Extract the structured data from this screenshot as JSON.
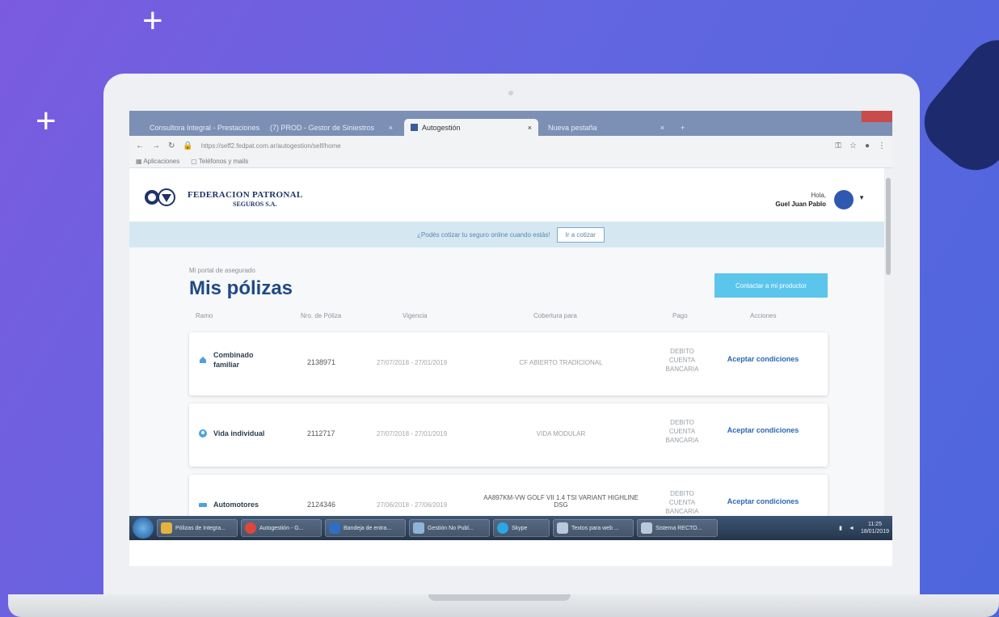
{
  "browser": {
    "tabs": [
      {
        "label": "Consultora Integral - Prestaciones"
      },
      {
        "label": "(7) PROD - Gestor de Siniestros"
      },
      {
        "label": "Autogestión"
      },
      {
        "label": "Nueva pestaña"
      }
    ],
    "url": "https://seff2.fedpat.com.ar/autogestion/self/home",
    "bookmarks": [
      {
        "label": "Aplicaciones"
      },
      {
        "label": "Teléfonos y mails"
      }
    ]
  },
  "header": {
    "brand_line1": "FEDERACION PATRONAL",
    "brand_line2": "SEGUROS S.A.",
    "greeting": "Hola,",
    "user_name": "Guel Juan Pablo"
  },
  "banner": {
    "text": "¿Podés cotizar tu seguro online cuando estás!",
    "button": "Ir a cotizar"
  },
  "main": {
    "subtitle": "Mi portal de asegurado",
    "title": "Mis pólizas",
    "cta_button": "Contactar a mi productor",
    "columns": [
      "Ramo",
      "Nro. de Póliza",
      "Vigencia",
      "Cobertura para",
      "Pago",
      "Acciones"
    ],
    "policies": [
      {
        "ramo": "Combinado familiar",
        "ramo_icon": "home-icon",
        "numero": "2138971",
        "vigencia": "27/07/2018 - 27/01/2019",
        "cobertura": "CF ABIERTO TRADICIONAL",
        "pago": "DEBITO CUENTA BANCARIA",
        "accion": "Aceptar condiciones"
      },
      {
        "ramo": "Vida individual",
        "ramo_icon": "person-icon",
        "numero": "2112717",
        "vigencia": "27/07/2018 - 27/01/2019",
        "cobertura": "VIDA MODULAR",
        "pago": "DEBITO CUENTA BANCARIA",
        "accion": "Aceptar condiciones"
      },
      {
        "ramo": "Automotores",
        "ramo_icon": "car-icon",
        "numero": "2124346",
        "vigencia": "27/06/2018 - 27/06/2019",
        "cobertura": "AA897KM-VW GOLF VII 1.4 TSI VARIANT HIGHLINE DSG",
        "pago": "DEBITO CUENTA BANCARIA",
        "accion": "Aceptar condiciones"
      }
    ]
  },
  "taskbar": {
    "items": [
      {
        "label": "Pólizas de Integra..."
      },
      {
        "label": "Autogestión - G..."
      },
      {
        "label": "Bandeja de entra..."
      },
      {
        "label": "Gestión No Publ..."
      },
      {
        "label": "Skype"
      },
      {
        "label": "Textos para web ..."
      },
      {
        "label": "Sistema RECTO..."
      }
    ],
    "time": "11:25",
    "date": "18/01/2019"
  },
  "colors": {
    "background_start": "#7b5be0",
    "background_end": "#4d66dc",
    "title": "#1e4a86",
    "accent": "#5bc5ec",
    "link": "#2d66b5"
  }
}
